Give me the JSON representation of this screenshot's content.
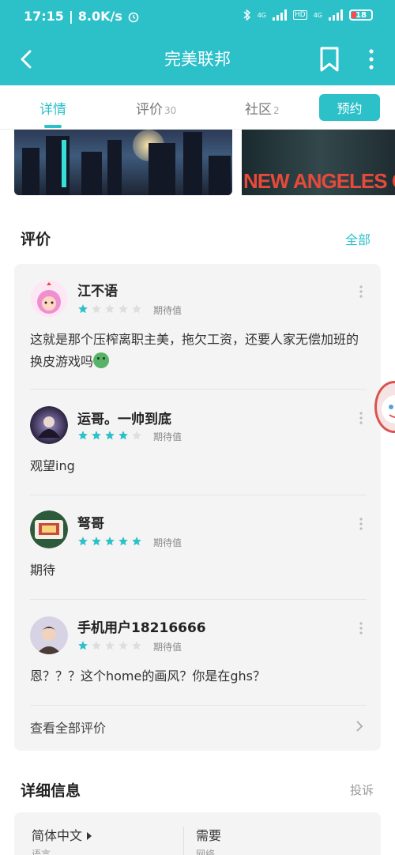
{
  "status_bar": {
    "time": "17:15",
    "net_speed": "8.0K/s",
    "net_label_1": "4G",
    "net_label_2": "4G",
    "hd_label": "HD",
    "battery": "18"
  },
  "app_bar": {
    "title": "完美联邦"
  },
  "tabs": {
    "details": "详情",
    "reviews": "评价",
    "reviews_count": "30",
    "community": "社区",
    "community_count": "2",
    "reserve_button": "预约"
  },
  "screenshots": {
    "shot2_text": "NEW ANGELES CITY"
  },
  "reviews_section": {
    "title": "评价",
    "all_link": "全部",
    "items": [
      {
        "user": "江不语",
        "stars": 1,
        "label": "期待值",
        "text": "这就是那个压榨离职主美，拖欠工资，还要人家无偿加班的换皮游戏吗"
      },
      {
        "user": "运哥。一帅到底",
        "stars": 4,
        "label": "期待值",
        "text": "观望ing"
      },
      {
        "user": "弩哥",
        "stars": 5,
        "label": "期待值",
        "text": "期待"
      },
      {
        "user": "手机用户18216666",
        "stars": 1,
        "label": "期待值",
        "text": "恩？？？这个home的画风？你是在ghs？"
      }
    ],
    "view_all": "查看全部评价"
  },
  "details_section": {
    "title": "详细信息",
    "report_link": "投诉",
    "language_value": "简体中文",
    "language_label": "语言",
    "network_value": "需要",
    "network_label": "网络"
  },
  "colors": {
    "accent": "#2cc0c9",
    "star_on": "#2cc0c9",
    "star_off": "#dedede"
  }
}
